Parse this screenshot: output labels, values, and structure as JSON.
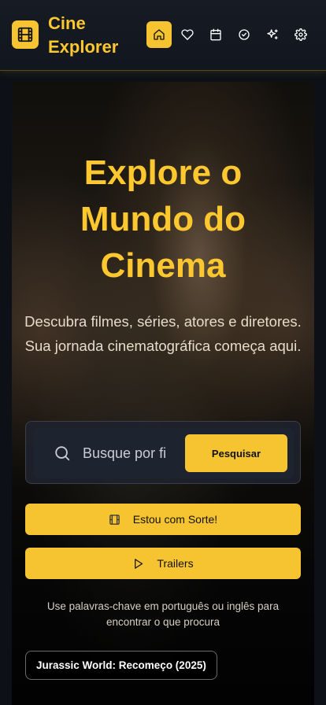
{
  "header": {
    "brand": "Cine Explorer",
    "brand_line1": "Cine",
    "brand_line2": "Explorer",
    "nav_icons": [
      "home-icon",
      "heart-icon",
      "calendar-icon",
      "check-circle-icon",
      "sparkles-icon",
      "gear-icon"
    ],
    "active_nav": "home-icon"
  },
  "hero": {
    "title_lines": [
      "Explore o",
      "Mundo do",
      "Cinema"
    ],
    "subtitle": "Descubra filmes, séries, atores e diretores. Sua jornada cinematográfica começa aqui."
  },
  "search": {
    "placeholder": "Busque por fi",
    "button_label": "Pesquisar"
  },
  "actions": {
    "lucky_label": "Estou com Sorte!",
    "trailers_label": "Trailers"
  },
  "hint": "Use palavras-chave em português ou inglês para encontrar o que procura",
  "featured": {
    "label": "Jurassic World: Recomeço (2025)"
  },
  "colors": {
    "accent": "#f5c430",
    "background": "#0d1117",
    "header": "#161b24"
  }
}
